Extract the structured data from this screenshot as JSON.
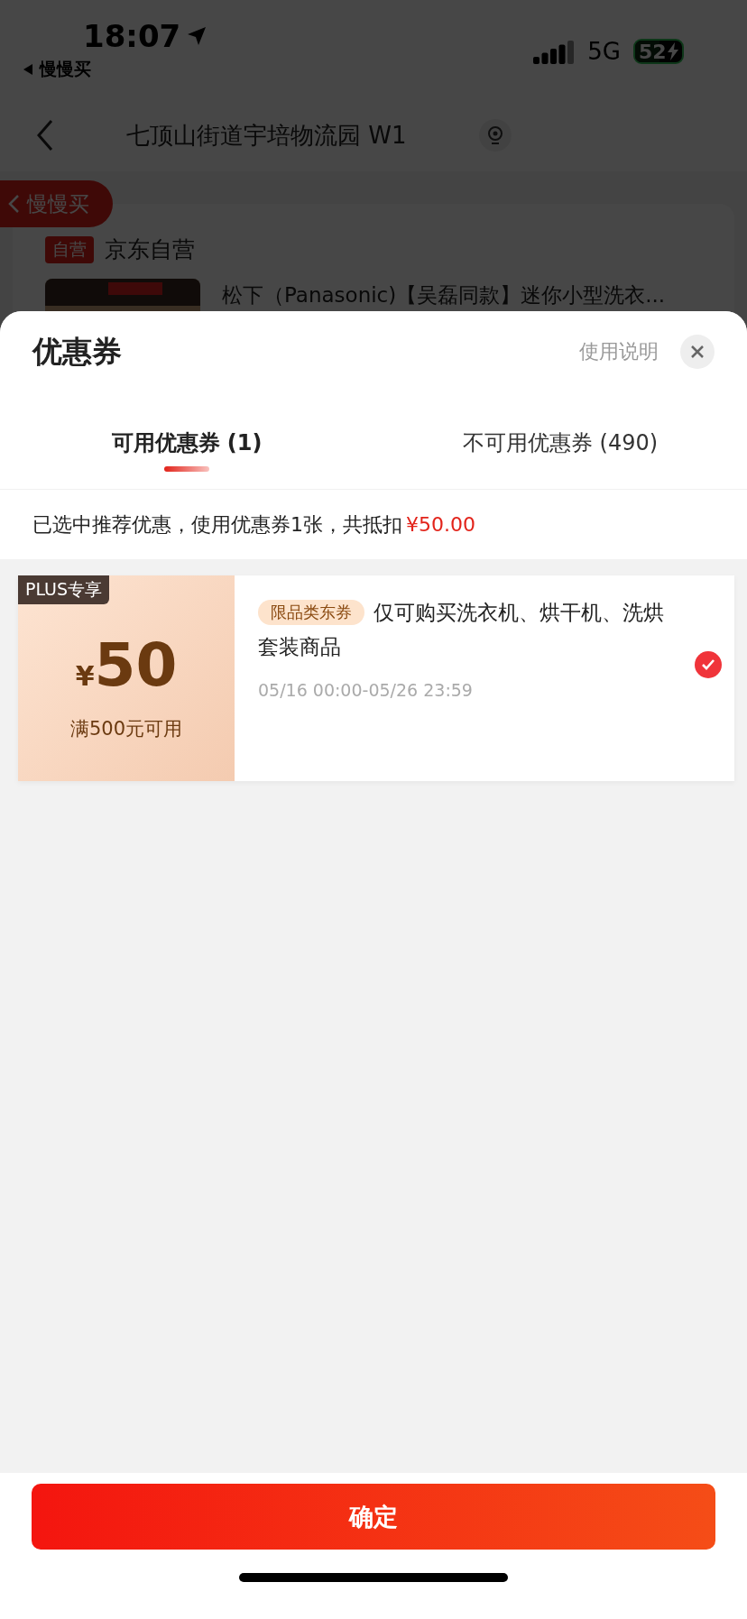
{
  "status_bar": {
    "time": "18:07",
    "back_app": "慢慢买",
    "network": "5G",
    "battery": "52"
  },
  "nav": {
    "title": "七顶山街道宇培物流园 W1"
  },
  "floating_back": {
    "label": "慢慢买"
  },
  "order": {
    "shop_badge": "自营",
    "shop": "京东自营",
    "product_title": "松下（Panasonic)【吴磊同款】迷你小型洗衣..."
  },
  "sheet": {
    "title": "优惠券",
    "help": "使用说明",
    "tabs": [
      {
        "label": "可用优惠券 (1)",
        "selected": true
      },
      {
        "label": "不可用优惠券 (490)",
        "selected": false
      }
    ],
    "summary": {
      "text": "已选中推荐优惠，使用优惠券1张，共抵扣",
      "amount": "¥50.00"
    },
    "coupons": [
      {
        "badge": "PLUS专享",
        "currency": "¥",
        "amount": "50",
        "condition": "满500元可用",
        "tag": "限品类东券",
        "description": "仅可购买洗衣机、烘干机、洗烘套装商品",
        "validity": "05/16 00:00-05/26 23:59",
        "selected": true
      }
    ]
  },
  "confirm": "确定"
}
